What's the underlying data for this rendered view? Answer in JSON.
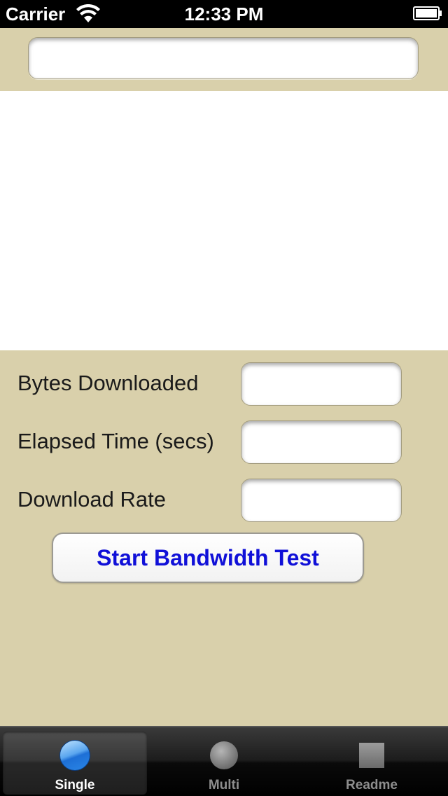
{
  "status_bar": {
    "carrier": "Carrier",
    "time": "12:33 PM",
    "wifi_icon": "wifi-icon",
    "battery_icon": "battery-icon"
  },
  "url_field": {
    "value": "",
    "placeholder": ""
  },
  "stats": {
    "bytes_downloaded": {
      "label": "Bytes Downloaded",
      "value": ""
    },
    "elapsed_time": {
      "label": "Elapsed Time (secs)",
      "value": ""
    },
    "download_rate": {
      "label": "Download Rate",
      "value": ""
    }
  },
  "start_button": {
    "label": "Start Bandwidth Test"
  },
  "tab_bar": {
    "tabs": [
      {
        "label": "Single",
        "icon": "circle-blue-icon",
        "selected": true
      },
      {
        "label": "Multi",
        "icon": "circle-gray-icon",
        "selected": false
      },
      {
        "label": "Readme",
        "icon": "square-gray-icon",
        "selected": false
      }
    ]
  },
  "colors": {
    "panel_background": "#d9d0ab",
    "button_text": "#1010d8",
    "tab_bar": "#000000"
  }
}
